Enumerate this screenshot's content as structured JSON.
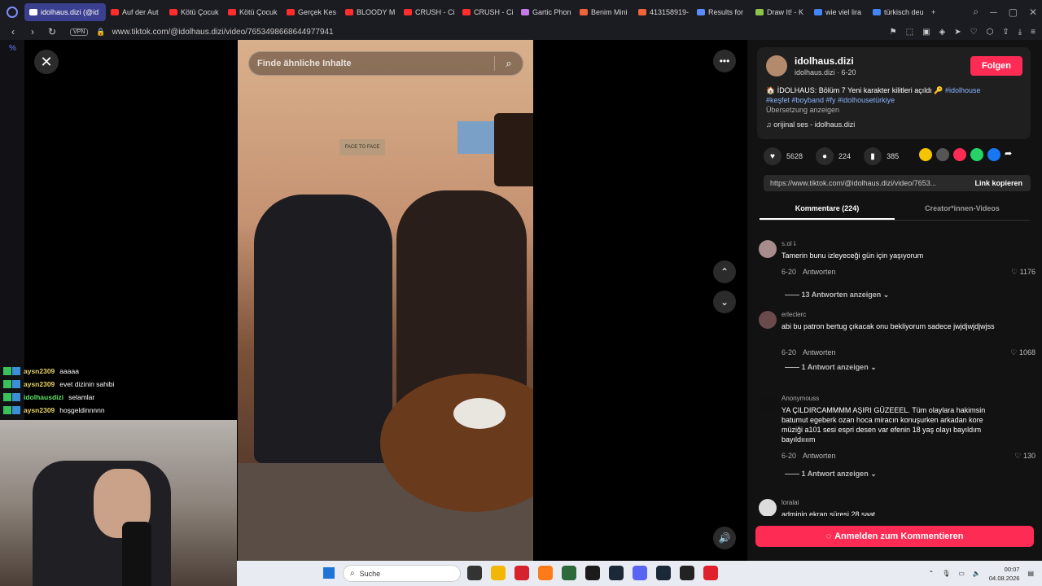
{
  "browser": {
    "tabs": [
      {
        "label": "idolhaus.dizi (@id",
        "active": true,
        "fav": "#ffffff"
      },
      {
        "label": "Auf der Aut",
        "fav": "#ff2d2d"
      },
      {
        "label": "Kötü Çocuk",
        "fav": "#ff2d2d"
      },
      {
        "label": "Kötü Çocuk",
        "fav": "#ff2d2d"
      },
      {
        "label": "Gerçek Kes",
        "fav": "#ff2d2d"
      },
      {
        "label": "BLOODY M",
        "fav": "#ff2d2d"
      },
      {
        "label": "CRUSH - Ci",
        "fav": "#ff2d2d"
      },
      {
        "label": "CRUSH - Ci",
        "fav": "#ff2d2d"
      },
      {
        "label": "Gartic Phon",
        "fav": "#c57ae8"
      },
      {
        "label": "Benim Mini",
        "fav": "#f0643c"
      },
      {
        "label": "413158919-",
        "fav": "#f0643c"
      },
      {
        "label": "Results for",
        "fav": "#5a8cff"
      },
      {
        "label": "Draw It! - K",
        "fav": "#8bc34a"
      },
      {
        "label": "wie viel lira",
        "fav": "#4285f4"
      },
      {
        "label": "türkisch deu",
        "fav": "#4285f4"
      }
    ],
    "new_tab": "+",
    "vpn_label": "VPN",
    "url": "www.tiktok.com/@idolhaus.dizi/video/7653498668644977941"
  },
  "sidebar": {
    "pct": "%"
  },
  "video": {
    "search_placeholder": "Finde ähnliche Inhalte",
    "sign_text": "FACE TO FACE"
  },
  "panel": {
    "author_name": "idolhaus.dizi",
    "author_sub": "idolhaus.dizi · 6-20",
    "follow_label": "Folgen",
    "desc_text": "🏠 İDOLHAUS: Bölüm 7 Yeni karakter kilitleri açıldı 🔑",
    "desc_tag1": "#idolhouse",
    "desc_tags": "#keşfet #boyband #fy #idolhousetürkiye",
    "translate": "Übersetzung anzeigen",
    "music": "orijinal ses - idolhaus.dizi",
    "likes": "5628",
    "comments": "224",
    "saves": "385",
    "share_colors": [
      "#f5c400",
      "#555555",
      "#fe2c55",
      "#25d366",
      "#1877f2"
    ],
    "link_url": "https://www.tiktok.com/@idolhaus.dizi/video/7653...",
    "copy_label": "Link kopieren",
    "tab_comments": "Kommentare (224)",
    "tab_creator": "Creator*innen-Videos",
    "comment_cta": "Anmelden zum Kommentieren",
    "comment_list": [
      {
        "user": "ꜱ.ol⇂",
        "text": "Tamerin bunu izleyeceği gün için yaşıyorum",
        "date": "6-20",
        "reply": "Antworten",
        "likes": "1176",
        "more": "13 Antworten anzeigen",
        "avatar": "#a88c8c"
      },
      {
        "user": "erleclerc",
        "text": "abi bu patron bertug çıkacak onu bekliyorum sadece jwjdjwjdjwjss",
        "date": "6-20",
        "reply": "Antworten",
        "likes": "1068",
        "more": "1 Antwort anzeigen",
        "avatar": "#6a4a4a"
      },
      {
        "user": "Anonymouss",
        "text": "YA ÇILDIRCAMMMM AŞIRI GÜZEEEL. Tüm olaylara hakimsin batumut egeberk ozan hoca miracın konuşurken arkadan kore müziği a101 sesi espri desen var efenin 18 yaş olayı bayıldım bayıldıııım",
        "date": "6-20",
        "reply": "Antworten",
        "likes": "130",
        "more": "1 Antwort anzeigen",
        "avatar": "#111111"
      },
      {
        "user": "loralai",
        "text": "adminin ekran süresi 28 saat",
        "date": "",
        "reply": "",
        "likes": "",
        "more": "",
        "avatar": "#dcdcdc"
      }
    ]
  },
  "chat": [
    {
      "user": "aysn2309",
      "msg": "aaaaa",
      "color": "#e8d36a"
    },
    {
      "user": "aysn2309",
      "msg": "evet dizinin sahibi",
      "color": "#e8d36a"
    },
    {
      "user": "idolhausdizi",
      "msg": "selamlar",
      "color": "#63e36a"
    },
    {
      "user": "aysn2309",
      "msg": "hoşgeldinnnnn",
      "color": "#e8d36a"
    }
  ],
  "taskbar": {
    "search_label": "Suche",
    "app_colors": [
      "#333333",
      "#f2b705",
      "#d6222d",
      "#ff7a18",
      "#2d6a3a",
      "#1b1b1b",
      "#1b2838",
      "#5865f2",
      "#1b2838",
      "#222222",
      "#e0202a"
    ],
    "time": "00:07",
    "date": "04.08.2026"
  }
}
